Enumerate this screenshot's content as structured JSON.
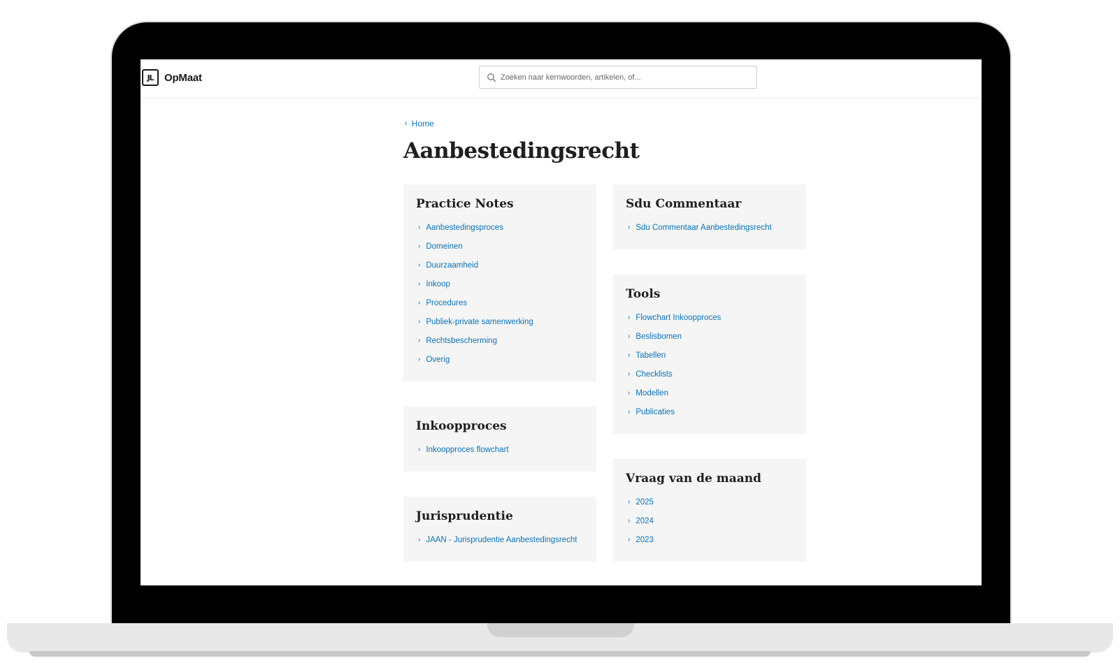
{
  "header": {
    "logo_text": "OpMaat",
    "search_placeholder": "Zoeken naar kernwoorden, artikelen, of..."
  },
  "breadcrumb": {
    "label": "Home"
  },
  "page_title": "Aanbestedingsrecht",
  "cards": {
    "practice_notes": {
      "title": "Practice Notes",
      "items": [
        "Aanbestedingsproces",
        "Domeinen",
        "Duurzaamheid",
        "Inkoop",
        "Procedures",
        "Publiek-private samenwerking",
        "Rechtsbescherming",
        "Overig"
      ]
    },
    "inkoopproces": {
      "title": "Inkoopproces",
      "items": [
        "Inkoopproces flowchart"
      ]
    },
    "jurisprudentie": {
      "title": "Jurisprudentie",
      "items": [
        "JAAN - Jurisprudentie Aanbestedingsrecht"
      ]
    },
    "sdu_commentaar": {
      "title": "Sdu Commentaar",
      "items": [
        "Sdu Commentaar Aanbestedingsrecht"
      ]
    },
    "tools": {
      "title": "Tools",
      "items": [
        "Flowchart Inkoopproces",
        "Beslisbomen",
        "Tabellen",
        "Checklists",
        "Modellen",
        "Publicaties"
      ]
    },
    "vraag_van_de_maand": {
      "title": "Vraag van de maand",
      "items": [
        "2025",
        "2024",
        "2023"
      ]
    }
  },
  "colors": {
    "link": "#0a72b8",
    "card_bg": "#f5f5f5",
    "frame": "#000000"
  }
}
